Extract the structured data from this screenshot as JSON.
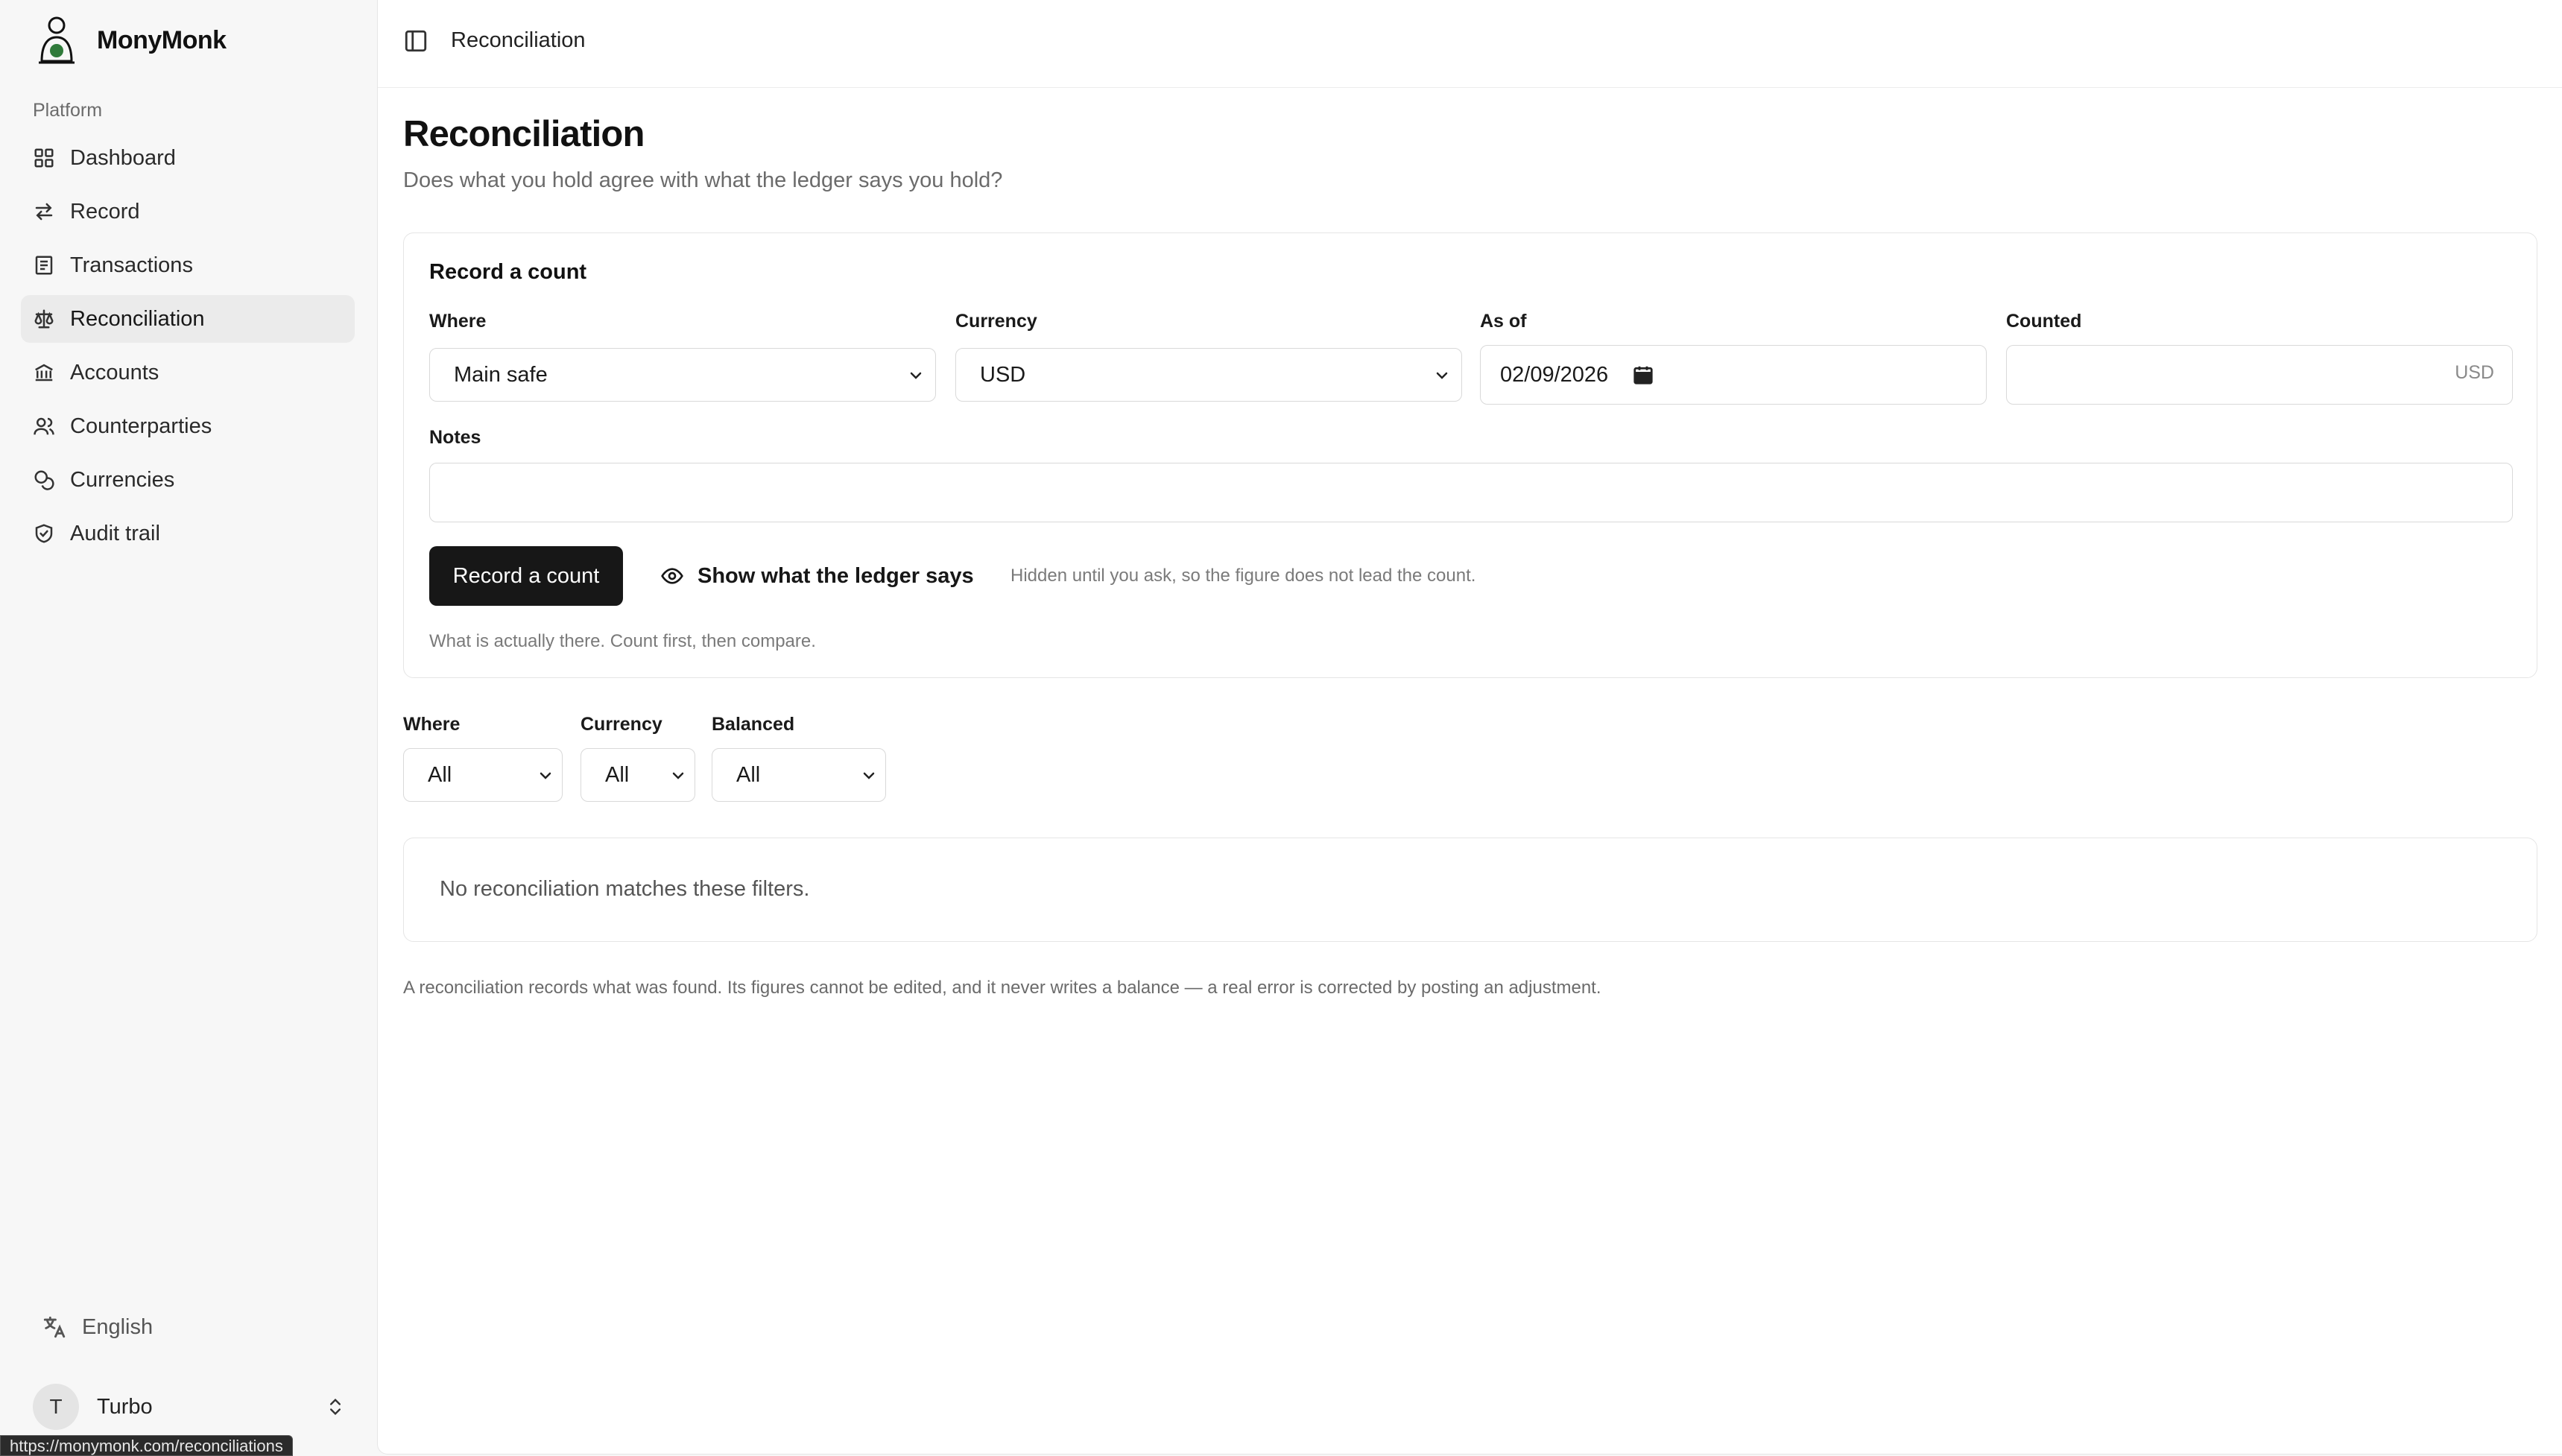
{
  "brand": {
    "name": "MonyMonk"
  },
  "sidebar": {
    "group_label": "Platform",
    "items": [
      {
        "label": "Dashboard",
        "icon": "grid-icon"
      },
      {
        "label": "Record",
        "icon": "swap-arrows-icon"
      },
      {
        "label": "Transactions",
        "icon": "receipt-icon"
      },
      {
        "label": "Reconciliation",
        "icon": "scale-icon",
        "active": true
      },
      {
        "label": "Accounts",
        "icon": "bank-icon"
      },
      {
        "label": "Counterparties",
        "icon": "users-icon"
      },
      {
        "label": "Currencies",
        "icon": "coins-icon"
      },
      {
        "label": "Audit trail",
        "icon": "shield-check-icon"
      }
    ],
    "language": "English",
    "user": {
      "initial": "T",
      "name": "Turbo"
    }
  },
  "status_bar": {
    "url": "https://monymonk.com/reconciliations"
  },
  "header": {
    "breadcrumb": "Reconciliation"
  },
  "page": {
    "title": "Reconciliation",
    "subtitle": "Does what you hold agree with what the ledger says you hold?"
  },
  "form": {
    "title": "Record a count",
    "where": {
      "label": "Where",
      "value": "Main safe"
    },
    "currency": {
      "label": "Currency",
      "value": "USD"
    },
    "as_of": {
      "label": "As of",
      "value": "02/09/2026"
    },
    "counted": {
      "label": "Counted",
      "value": "",
      "suffix": "USD"
    },
    "notes": {
      "label": "Notes",
      "value": ""
    },
    "submit_label": "Record a count",
    "show_ledger_label": "Show what the ledger says",
    "show_ledger_hint": "Hidden until you ask, so the figure does not lead the count.",
    "helper": "What is actually there. Count first, then compare."
  },
  "filters": {
    "where": {
      "label": "Where",
      "value": "All"
    },
    "currency": {
      "label": "Currency",
      "value": "All"
    },
    "balanced": {
      "label": "Balanced",
      "value": "All"
    }
  },
  "results": {
    "empty_message": "No reconciliation matches these filters."
  },
  "footnote": "A reconciliation records what was found. Its figures cannot be edited, and it never writes a balance — a real error is corrected by posting an adjustment.",
  "colors": {
    "primary_button": "#171717",
    "active_nav_bg": "#ebebeb",
    "sidebar_bg": "#f7f7f7"
  }
}
